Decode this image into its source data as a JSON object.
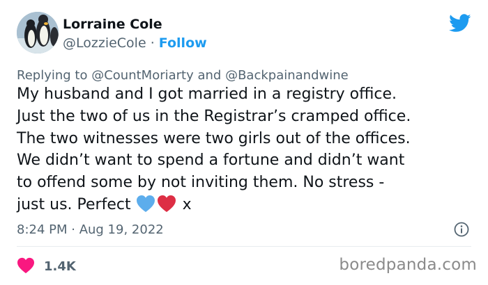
{
  "author": {
    "name": "Lorraine Cole",
    "handle": "@LozzieCole",
    "separator": " · ",
    "follow_label": "Follow",
    "avatar": "penguin-avatar"
  },
  "header": {
    "icon": "twitter-bird-icon",
    "brand_color": "#1d9bf0"
  },
  "reply": {
    "prefix": "Replying to ",
    "mention_1": "@CountMoriarty",
    "conjunction": " and ",
    "mention_2": "@Backpainandwine"
  },
  "tweet": {
    "text": "My husband and I got married in a registry office.\nJust the two of us in the Registrar’s cramped office.\nThe two witnesses were two girls out of the offices.\nWe didn’t want to spend a fortune and didn’t want\nto offend some by not inviting them. No stress -\njust us. Perfect ",
    "emoji": [
      "blue-heart-icon",
      "red-heart-icon"
    ],
    "trailing_text": " x"
  },
  "meta": {
    "timestamp": "8:24 PM · Aug 19, 2022",
    "info_icon": "info-icon"
  },
  "actions": {
    "like_icon": "heart-icon",
    "like_color": "#f91880",
    "like_count": "1.4K"
  },
  "watermark": {
    "text": "boredpanda.com"
  }
}
